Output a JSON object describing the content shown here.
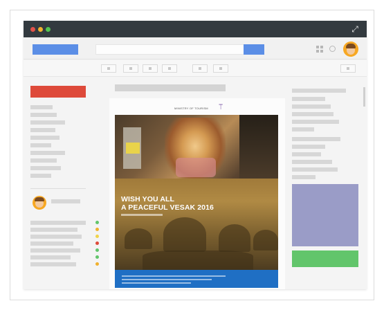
{
  "window": {
    "traffic_lights": [
      {
        "name": "close",
        "color": "#e0524a"
      },
      {
        "name": "minimize",
        "color": "#f0b12e"
      },
      {
        "name": "zoom",
        "color": "#52c451"
      }
    ],
    "expand_icon": "⤢"
  },
  "header": {
    "logo_color": "#5b8ee6",
    "search_button_color": "#5b8ee6",
    "icons": [
      "apps-grid-icon",
      "notification-icon",
      "user-avatar"
    ]
  },
  "sidebar": {
    "compose_color": "#de4a3a",
    "status_dots": [
      "#62c56b",
      "#f0b12e",
      "#f0d44a",
      "#de4a3a",
      "#62c56b",
      "#62c56b",
      "#f0b12e"
    ]
  },
  "email": {
    "brand_text": "MINISTRY OF TOURISM",
    "brand_mark": "⟙",
    "headline_line1": "WISH YOU ALL",
    "headline_line2": "A PEACEFUL VESAK 2016"
  },
  "right_panel": {
    "ad_colors": [
      "#9a9cc7",
      "#62c56b"
    ]
  }
}
